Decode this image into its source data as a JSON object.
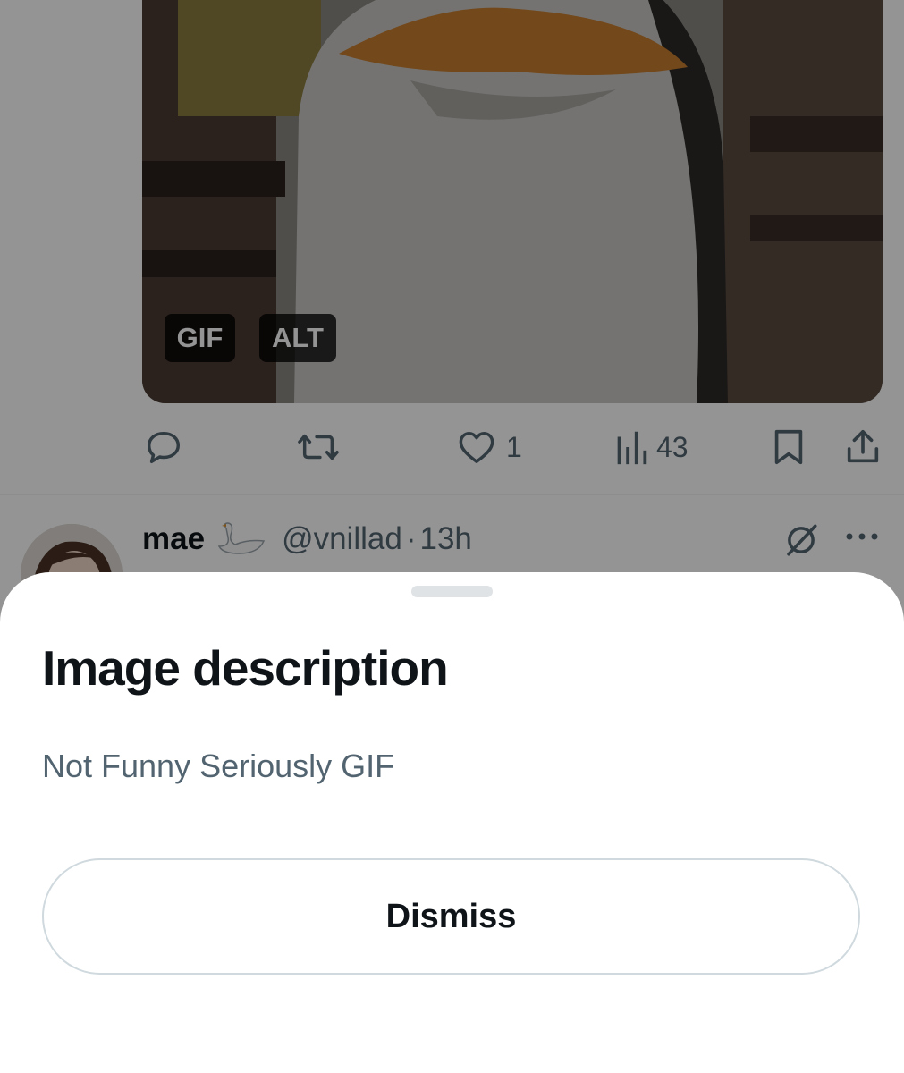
{
  "media": {
    "badges": {
      "gif": "GIF",
      "alt": "ALT"
    }
  },
  "actions": {
    "reply_icon": "reply-icon",
    "repost_icon": "repost-icon",
    "like_icon": "heart-icon",
    "like_count": "1",
    "views_icon": "views-icon",
    "views_count": "43",
    "bookmark_icon": "bookmark-icon",
    "share_icon": "share-icon"
  },
  "next_post": {
    "author": "mae",
    "author_emoji": "swan-icon",
    "handle": "@vnillad",
    "separator": "·",
    "time": "13h"
  },
  "sheet": {
    "title": "Image description",
    "description": "Not Funny Seriously GIF",
    "dismiss_label": "Dismiss"
  },
  "colors": {
    "text_primary": "#0f1419",
    "text_secondary": "#536471",
    "border": "#cfd9de",
    "overlay": "rgba(0,0,0,0.42)"
  }
}
